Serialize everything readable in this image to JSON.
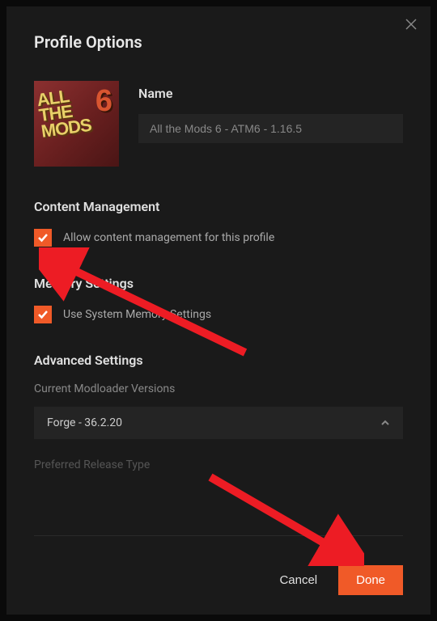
{
  "modal": {
    "title": "Profile Options",
    "profile": {
      "icon_line1": "ALL",
      "icon_line2": "THE",
      "icon_line3": "MODS",
      "icon_badge": "6",
      "name_label": "Name",
      "name_value": "All the Mods 6 - ATM6 - 1.16.5"
    },
    "sections": {
      "content_management": {
        "title": "Content Management",
        "checkbox_label": "Allow content management for this profile",
        "checked": true
      },
      "memory_settings": {
        "title": "Memory Settings",
        "checkbox_label": "Use System Memory Settings",
        "checked": true
      },
      "advanced_settings": {
        "title": "Advanced Settings",
        "modloader_label": "Current Modloader Versions",
        "modloader_value": "Forge - 36.2.20",
        "release_type_label": "Preferred Release Type"
      }
    },
    "footer": {
      "cancel_label": "Cancel",
      "done_label": "Done"
    }
  },
  "colors": {
    "accent": "#f05a28",
    "background": "#1a1a1a",
    "input_bg": "#242424",
    "annotation": "#ed1c24"
  }
}
